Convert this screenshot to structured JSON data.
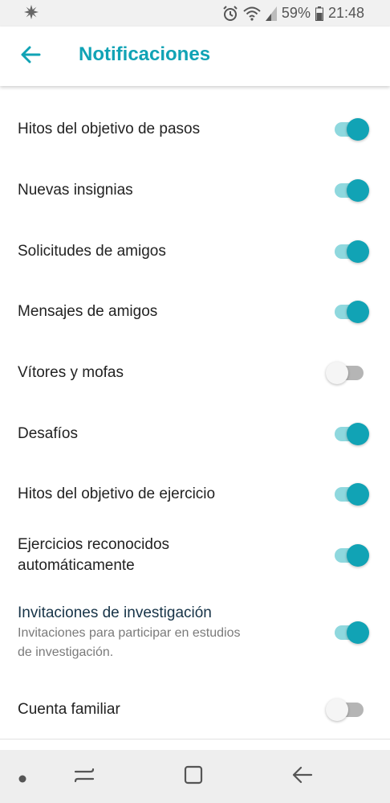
{
  "status_bar": {
    "battery": "59%",
    "time": "21:48",
    "icons": [
      "android-pinwheel-icon",
      "alarm-icon",
      "wifi-icon",
      "signal-icon",
      "battery-icon"
    ]
  },
  "app_bar": {
    "title": "Notificaciones",
    "back_icon": "arrow-left-icon",
    "accent_color": "#11a3b5"
  },
  "settings": [
    {
      "label": "Hitos del objetivo de pasos",
      "enabled": true
    },
    {
      "label": "Nuevas insignias",
      "enabled": true
    },
    {
      "label": "Solicitudes de amigos",
      "enabled": true
    },
    {
      "label": "Mensajes de amigos",
      "enabled": true
    },
    {
      "label": "Vítores y mofas",
      "enabled": false
    },
    {
      "label": "Desafíos",
      "enabled": true
    },
    {
      "label": "Hitos del objetivo de ejercicio",
      "enabled": true
    },
    {
      "label_line1": "Ejercicios reconocidos",
      "label_line2": "automáticamente",
      "enabled": true
    },
    {
      "label": "Invitaciones de investigación",
      "description_line1": "Invitaciones para participar en estudios",
      "description_line2": "de investigación.",
      "enabled": true
    },
    {
      "label": "Cuenta familiar",
      "enabled": false
    }
  ],
  "nav_bar": {
    "icons": [
      "dot-icon",
      "recent-apps-icon",
      "home-icon",
      "back-icon"
    ]
  }
}
